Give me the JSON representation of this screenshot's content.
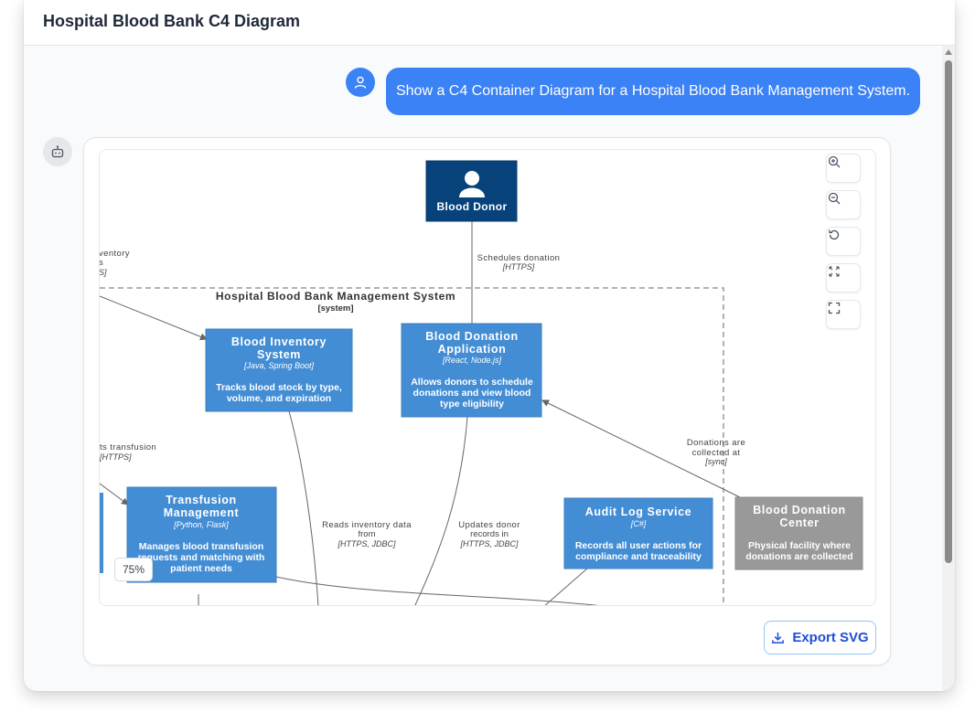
{
  "header": {
    "title": "Hospital Blood Bank C4 Diagram"
  },
  "chat": {
    "user_message": "Show a C4 Container Diagram for a Hospital Blood Bank Management System.",
    "user_avatar_icon": "user-icon",
    "bot_avatar_icon": "robot-icon"
  },
  "diagram": {
    "person": {
      "label": "Blood Donor",
      "icon": "person-icon"
    },
    "boundary": {
      "title": "Hospital Blood Bank Management System",
      "tag": "[system]"
    },
    "containers": {
      "inventory": {
        "title_1": "Blood Inventory",
        "title_2": "System",
        "tech": "[Java, Spring Boot]",
        "desc_1": "Tracks blood stock by type,",
        "desc_2": "volume, and expiration"
      },
      "donation_app": {
        "title_1": "Blood Donation",
        "title_2": "Application",
        "tech": "[React, Node.js]",
        "desc_1": "Allows donors to schedule",
        "desc_2": "donations and view blood",
        "desc_3": "type eligibility"
      },
      "transfusion": {
        "title_1": "Transfusion",
        "title_2": "Management",
        "tech": "[Python, Flask]",
        "desc_1": "Manages blood transfusion",
        "desc_2": "requests and matching with",
        "desc_3": "patient needs"
      },
      "audit": {
        "title": "Audit Log Service",
        "tech": "[C#]",
        "desc_1": "Records all user actions for",
        "desc_2": "compliance and traceability"
      },
      "center": {
        "title_1": "Blood Donation",
        "title_2": "Center",
        "desc_1": "Physical facility where",
        "desc_2": "donations are collected"
      }
    },
    "relationships": {
      "schedules": {
        "label": "Schedules donation",
        "tech": "[HTTPS]"
      },
      "inventory_partial": {
        "label_1": "ventory",
        "label_2": "s",
        "tech": "S]"
      },
      "transfusion_partial": {
        "label": "ts transfusion",
        "tech": "[HTTPS]"
      },
      "reads": {
        "label_1": "Reads inventory data",
        "label_2": "from",
        "tech": "[HTTPS, JDBC]"
      },
      "updates": {
        "label_1": "Updates donor",
        "label_2": "records in",
        "tech": "[HTTPS, JDBC]"
      },
      "collected": {
        "label_1": "Donations are",
        "label_2": "collected at",
        "tech": "[sync]"
      }
    },
    "colors": {
      "person": "#08427b",
      "container": "#438dd5",
      "external": "#999999",
      "boundary": "#9a9a9a"
    }
  },
  "controls": {
    "zoom_in_icon": "zoom-in-icon",
    "zoom_out_icon": "zoom-out-icon",
    "reset_icon": "reset-icon",
    "fit_icon": "fit-view-icon",
    "fullscreen_icon": "fullscreen-icon",
    "zoom_level": "75%",
    "export_label": "Export SVG",
    "export_icon": "download-icon"
  }
}
